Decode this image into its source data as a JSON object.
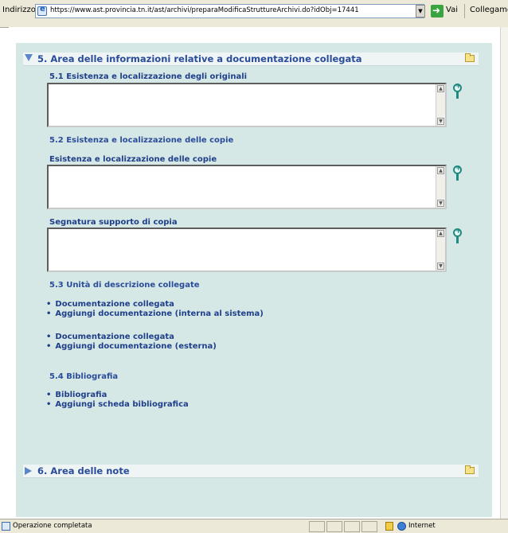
{
  "browser": {
    "address_label": "Indirizzo",
    "url": "https://www.ast.provincia.tn.it/ast/archivi/preparaModificaStruttureArchivi.do?idObj=17441",
    "go_label": "Vai",
    "links_label": "Collegamenti",
    "status_text": "Operazione completata",
    "zone_text": "Internet"
  },
  "section5": {
    "title": "5. Area delle informazioni relative a documentazione collegata",
    "originals_label": "5.1 Esistenza e localizzazione degli originali",
    "copies_heading": "5.2 Esistenza e localizzazione delle copie",
    "copies_label": "Esistenza e localizzazione delle copie",
    "segnatura_label": "Segnatura supporto di copia",
    "units_heading": "5.3 Unità di descrizione collegate",
    "links_internal": [
      "Documentazione collegata",
      "Aggiungi documentazione (interna al sistema)"
    ],
    "links_external": [
      "Documentazione collegata",
      "Aggiungi documentazione (esterna)"
    ],
    "bibliography_heading": "5.4 Bibliografia",
    "links_bibliography": [
      "Bibliografia",
      "Aggiungi scheda bibliografica"
    ]
  },
  "section6": {
    "title": "6. Area delle note"
  },
  "colors": {
    "panel_bg": "#d6e8e6",
    "heading_blue": "#2a4c9a",
    "accent_teal": "#1e8a80"
  }
}
